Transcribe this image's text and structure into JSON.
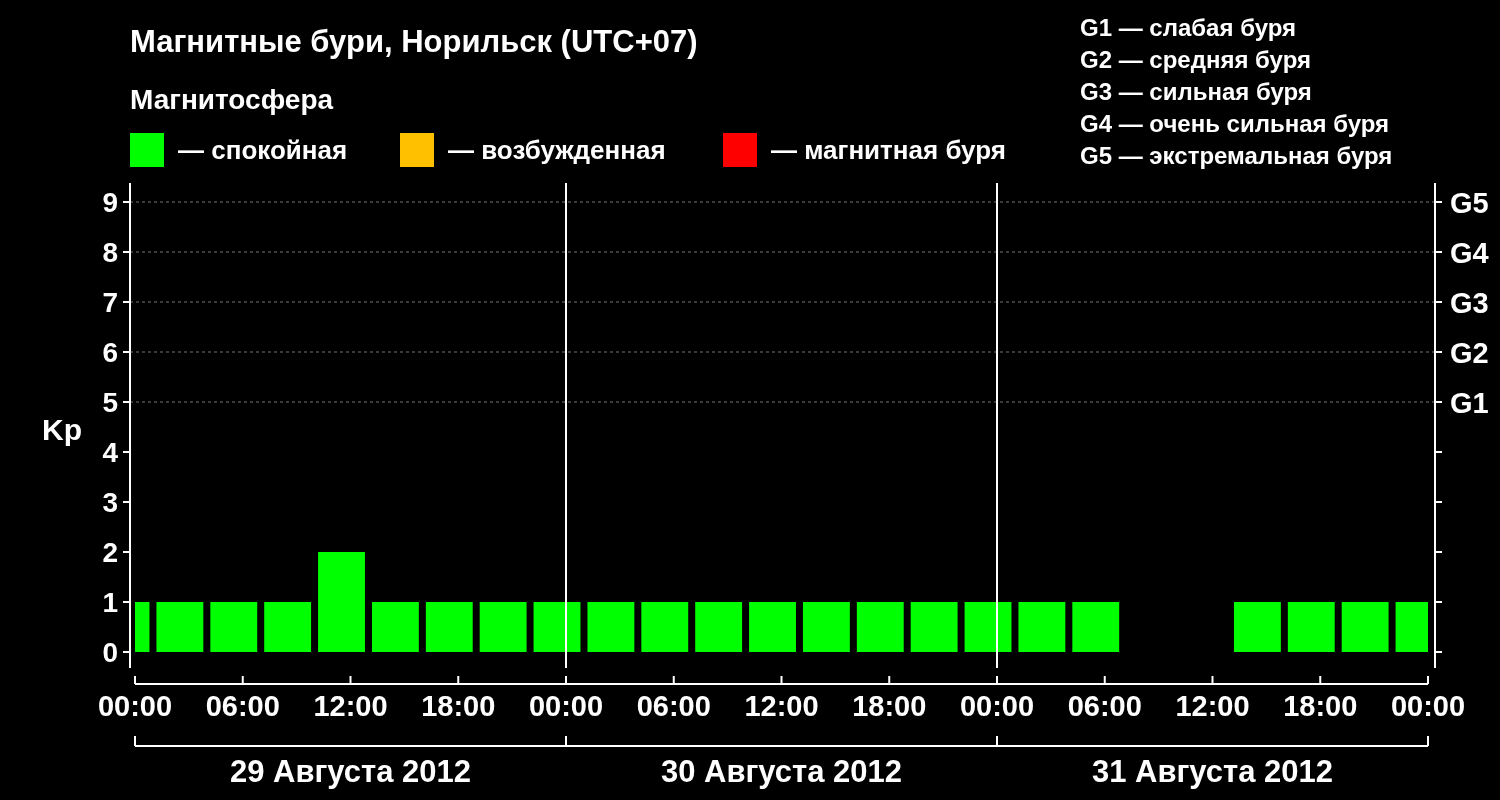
{
  "title": "Магнитные бури, Норильск (UTC+07)",
  "legend": {
    "heading": "Магнитосфера",
    "items": [
      {
        "label": "— спокойная",
        "color": "#00ff00"
      },
      {
        "label": "— возбужденная",
        "color": "#ffc000"
      },
      {
        "label": "— магнитная буря",
        "color": "#ff0000"
      }
    ]
  },
  "storm_scale": [
    "G1 — слабая буря",
    "G2 — средняя буря",
    "G3 — сильная буря",
    "G4 — очень сильная буря",
    "G5 — экстремальная буря"
  ],
  "chart": {
    "storm_levels": [
      "G5",
      "G4",
      "G3",
      "G2",
      "G1"
    ],
    "days": [
      "29 Августа 2012",
      "30 Августа 2012",
      "31 Августа 2012"
    ],
    "chart_data": {
      "type": "bar",
      "ylabel": "Kp",
      "x": [
        "2012-08-29T00:30",
        "2012-08-29T02:30",
        "2012-08-29T05:30",
        "2012-08-29T08:30",
        "2012-08-29T11:30",
        "2012-08-29T14:30",
        "2012-08-29T17:30",
        "2012-08-29T20:30",
        "2012-08-29T23:30",
        "2012-08-30T02:30",
        "2012-08-30T05:30",
        "2012-08-30T08:30",
        "2012-08-30T11:30",
        "2012-08-30T14:30",
        "2012-08-30T17:30",
        "2012-08-30T20:30",
        "2012-08-30T23:30",
        "2012-08-31T02:30",
        "2012-08-31T05:30",
        "2012-08-31T08:30",
        "2012-08-31T11:30",
        "2012-08-31T14:30",
        "2012-08-31T17:30",
        "2012-08-31T20:30",
        "2012-08-31T23:00"
      ],
      "series": [
        {
          "values": [
            1,
            1,
            1,
            1,
            2,
            1,
            1,
            1,
            1,
            1,
            1,
            1,
            1,
            1,
            1,
            1,
            1,
            1,
            1,
            null,
            null,
            1,
            1,
            1,
            1
          ]
        }
      ],
      "xlim": [
        "2012-08-29T00:00",
        "2012-09-01T00:00"
      ],
      "ylim": [
        -0.32,
        9.38
      ],
      "xticks": [
        {
          "value": "2012-08-29T00:00",
          "label": "00:00"
        },
        {
          "value": "2012-08-29T06:00",
          "label": "06:00"
        },
        {
          "value": "2012-08-29T12:00",
          "label": "12:00"
        },
        {
          "value": "2012-08-29T18:00",
          "label": "18:00"
        },
        {
          "value": "2012-08-30T00:00",
          "label": "00:00"
        },
        {
          "value": "2012-08-30T06:00",
          "label": "06:00"
        },
        {
          "value": "2012-08-30T12:00",
          "label": "12:00"
        },
        {
          "value": "2012-08-30T18:00",
          "label": "18:00"
        },
        {
          "value": "2012-08-31T00:00",
          "label": "00:00"
        },
        {
          "value": "2012-08-31T06:00",
          "label": "06:00"
        },
        {
          "value": "2012-08-31T12:00",
          "label": "12:00"
        },
        {
          "value": "2012-08-31T18:00",
          "label": "18:00"
        },
        {
          "value": "2012-09-01T00:00",
          "label": "00:00"
        }
      ],
      "yticks": [
        0,
        1,
        2,
        3,
        4,
        5,
        6,
        7,
        8,
        9
      ],
      "grid": true
    }
  }
}
